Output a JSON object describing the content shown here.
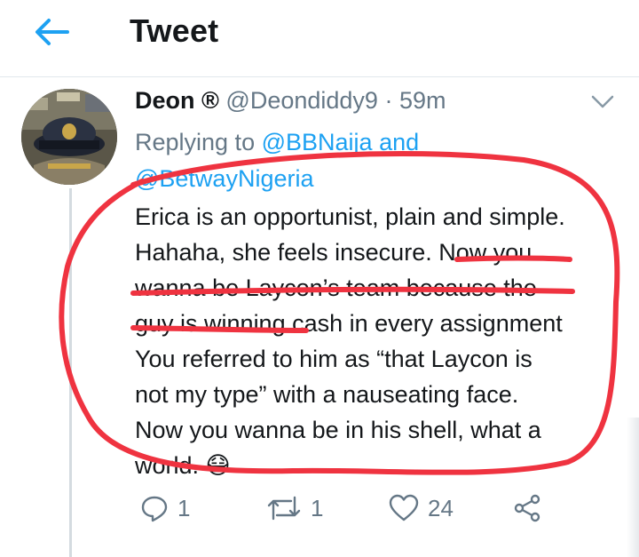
{
  "header": {
    "title": "Tweet"
  },
  "tweet": {
    "author_name": "Deon ®",
    "handle": "@Deondiddy9",
    "separator": "·",
    "time": "59m",
    "replying_prefix": "Replying to",
    "reply_to_1": "@BBNaija",
    "reply_and": "and",
    "reply_to_2": "@BetwayNigeria",
    "lines": [
      "Erica is an opportunist, plain and simple.",
      "Hahaha, she feels insecure. Now you",
      "wanna be Laycon’s team because the",
      "guy is winning cash in every assignment",
      "You referred to him as “that Laycon is",
      "not my type” with a nauseating face.",
      "Now you wanna be in his shell, what a",
      "world."
    ],
    "emoji": "😷"
  },
  "actions": {
    "replies": "1",
    "retweets": "1",
    "likes": "24"
  },
  "colors": {
    "accent": "#1da1f2",
    "muted": "#657786",
    "annotation": "#ef3340"
  },
  "icons": {
    "back": "arrow-left-icon",
    "menu": "chevron-down-icon",
    "reply": "comment-icon",
    "retweet": "retweet-icon",
    "like": "heart-icon",
    "share": "share-icon"
  }
}
